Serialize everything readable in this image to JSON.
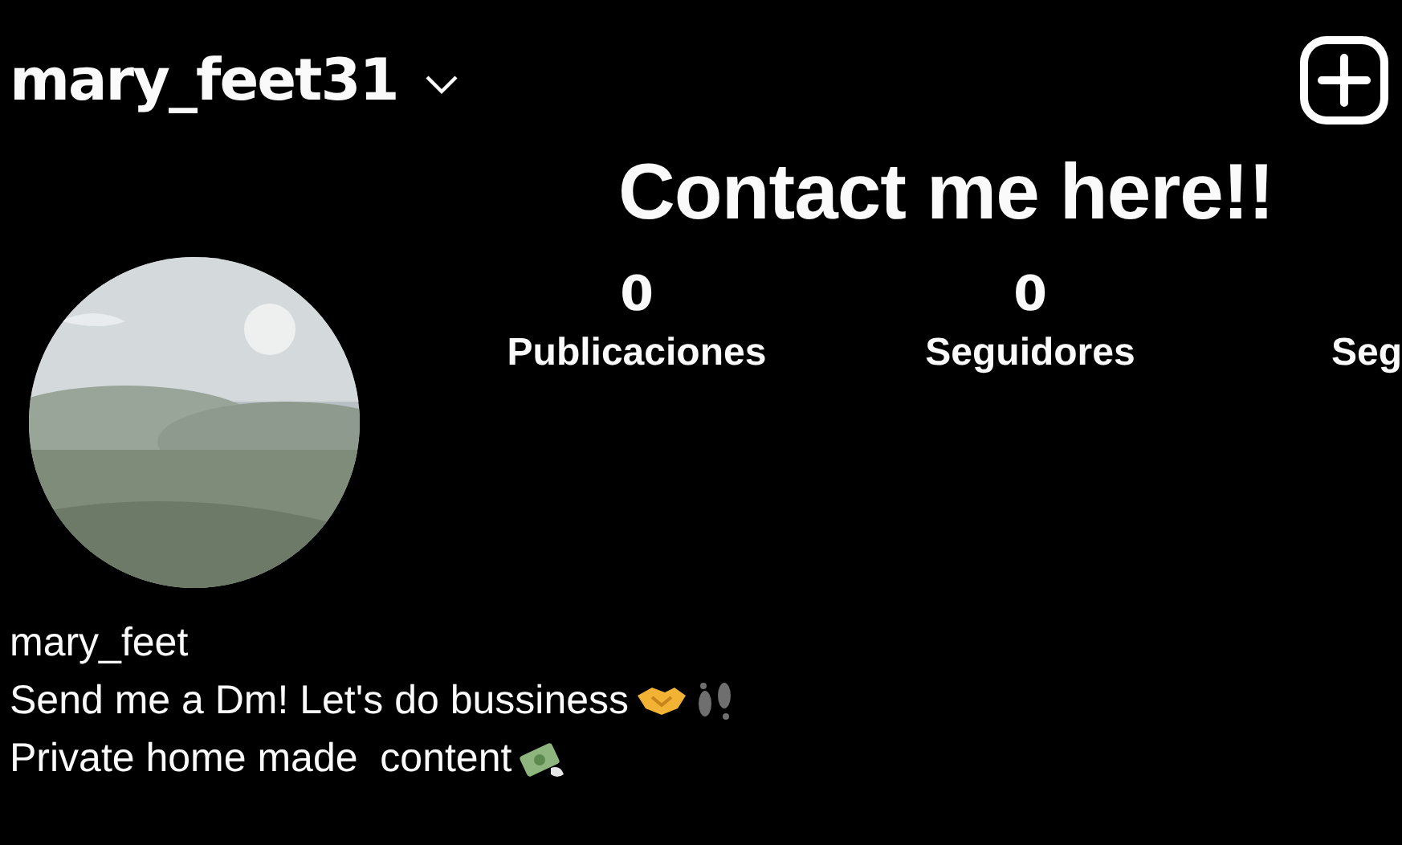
{
  "header": {
    "username": "mary_feet31"
  },
  "banner": "Contact me here!!",
  "stats": [
    {
      "count": "0",
      "label": "Publicaciones"
    },
    {
      "count": "0",
      "label": "Seguidores"
    },
    {
      "label": "Seg"
    }
  ],
  "bio": {
    "name": "mary_feet",
    "lines": [
      "Send me a Dm! Let's do bussiness",
      "Private home made  content"
    ]
  }
}
